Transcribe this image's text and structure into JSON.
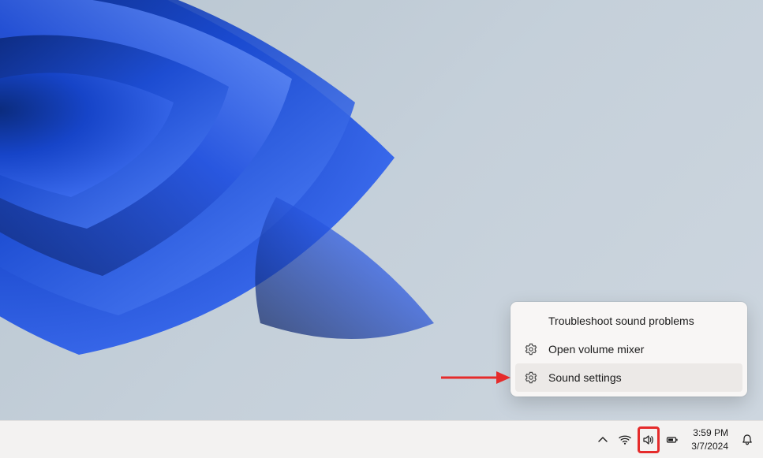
{
  "context_menu": {
    "items": [
      {
        "label": "Troubleshoot sound problems",
        "icon": null,
        "hovered": false
      },
      {
        "label": "Open volume mixer",
        "icon": "gear-icon",
        "hovered": false
      },
      {
        "label": "Sound settings",
        "icon": "gear-icon",
        "hovered": true
      }
    ]
  },
  "taskbar": {
    "time": "3:59 PM",
    "date": "3/7/2024",
    "icons": {
      "overflow": "chevron-up-icon",
      "wifi": "wifi-icon",
      "volume": "volume-icon",
      "battery": "battery-icon",
      "notifications": "bell-icon"
    },
    "highlighted_icon": "volume"
  },
  "annotations": {
    "arrow_color": "#e52b2b",
    "highlight_color": "#e52b2b"
  }
}
